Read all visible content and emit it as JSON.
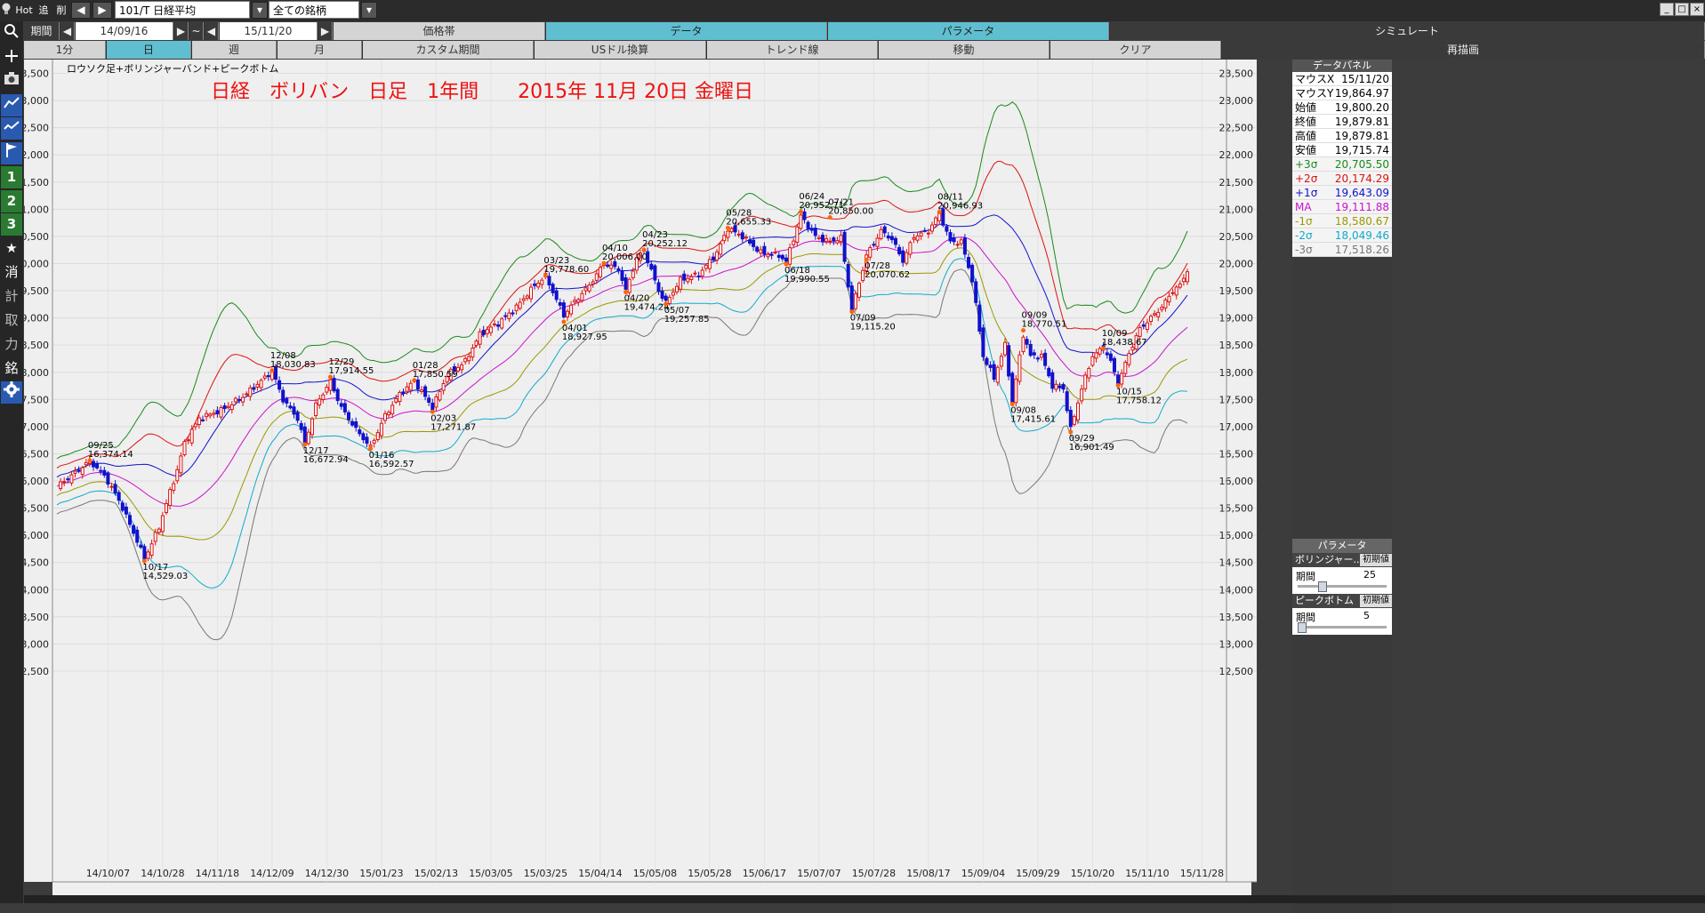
{
  "toolbar": {
    "hot": "Hot",
    "add": "追",
    "del": "削",
    "prev": "◀",
    "next": "▶",
    "symbol": "101/T 日経平均",
    "universe": "全ての銘柄",
    "period_label": "期間",
    "date_from": "14/09/16",
    "tilde": "~",
    "date_to": "15/11/20"
  },
  "menu_row": [
    "価格帯",
    "データ",
    "パラメータ",
    "シミュレート"
  ],
  "timeframe_row": [
    "1分",
    "日",
    "週",
    "月",
    "カスタム期間",
    "USドル換算",
    "トレンド線",
    "移動",
    "クリア",
    "再描画"
  ],
  "chart_subtitle": "ロウソク足+ボリンジャーバンド+ピークボトム",
  "chart_heading": "日経　ボリバン　日足　1年間　　2015年 11月 20日 金曜日",
  "data_panel": {
    "title": "データパネル",
    "rows": [
      {
        "k": "マウスX",
        "v": "15/11/20",
        "color": "#000000"
      },
      {
        "k": "マウスY",
        "v": "19,864.97",
        "color": "#000000"
      },
      {
        "k": "始値",
        "v": "19,800.20",
        "color": "#000000"
      },
      {
        "k": "終値",
        "v": "19,879.81",
        "color": "#000000"
      },
      {
        "k": "高値",
        "v": "19,879.81",
        "color": "#000000"
      },
      {
        "k": "安値",
        "v": "19,715.74",
        "color": "#000000"
      },
      {
        "k": "+3σ",
        "v": "20,705.50",
        "color": "#1a8a1a"
      },
      {
        "k": "+2σ",
        "v": "20,174.29",
        "color": "#dd1111"
      },
      {
        "k": "+1σ",
        "v": "19,643.09",
        "color": "#1111cc"
      },
      {
        "k": "MA",
        "v": "19,111.88",
        "color": "#cc11cc"
      },
      {
        "k": "-1σ",
        "v": "18,580.67",
        "color": "#999900"
      },
      {
        "k": "-2σ",
        "v": "18,049.46",
        "color": "#11aacc"
      },
      {
        "k": "-3σ",
        "v": "17,518.26",
        "color": "#777777"
      }
    ]
  },
  "params": {
    "title": "パラメータ",
    "groups": [
      {
        "name": "ボリンジャー...",
        "init": "初期値",
        "label": "期間",
        "value": "25",
        "level": 0.25
      },
      {
        "name": "ピークボトム",
        "init": "初期値",
        "label": "期間",
        "value": "5",
        "level": 0.0
      }
    ]
  },
  "colors": {
    "plus3": "#1a8a1a",
    "plus2": "#dd1111",
    "plus1": "#1111cc",
    "ma": "#cc11cc",
    "minus1": "#999900",
    "minus2": "#11aacc",
    "minus3": "#777777",
    "up": "#dd1111",
    "down": "#1111cc",
    "peak": "#ff6600"
  },
  "sidebar_icons": [
    "search-icon",
    "plus-icon",
    "camera-icon",
    "line-chart-icon",
    "line-chart-icon",
    "flag-icon",
    "1",
    "2",
    "3",
    "★",
    "消",
    "計",
    "取",
    "力",
    "銘",
    "gear-icon"
  ],
  "chart_data": {
    "type": "candlestick",
    "title": "日経　ボリバン　日足　1年間　　2015年 11月 20日 金曜日",
    "subtitle": "ロウソク足+ボリンジャーバンド+ピークボトム",
    "ylim": [
      12500,
      23700
    ],
    "yticks": [
      12500,
      13000,
      13500,
      14000,
      14500,
      15000,
      15500,
      16000,
      16500,
      17000,
      17500,
      18000,
      18500,
      19000,
      19500,
      20000,
      20500,
      21000,
      21500,
      22000,
      22500,
      23000,
      23500
    ],
    "x_labels": [
      {
        "i": 14,
        "label": "14/10/07"
      },
      {
        "i": 29,
        "label": "14/10/28"
      },
      {
        "i": 44,
        "label": "14/11/18"
      },
      {
        "i": 59,
        "label": "14/12/09"
      },
      {
        "i": 74,
        "label": "14/12/30"
      },
      {
        "i": 89,
        "label": "15/01/23"
      },
      {
        "i": 104,
        "label": "15/02/13"
      },
      {
        "i": 119,
        "label": "15/03/05"
      },
      {
        "i": 134,
        "label": "15/03/25"
      },
      {
        "i": 149,
        "label": "15/04/14"
      },
      {
        "i": 164,
        "label": "15/05/08"
      },
      {
        "i": 179,
        "label": "15/05/28"
      },
      {
        "i": 194,
        "label": "15/06/17"
      },
      {
        "i": 209,
        "label": "15/07/07"
      },
      {
        "i": 224,
        "label": "15/07/28"
      },
      {
        "i": 239,
        "label": "15/08/17"
      },
      {
        "i": 254,
        "label": "15/09/04"
      },
      {
        "i": 269,
        "label": "15/09/29"
      },
      {
        "i": 284,
        "label": "15/10/20"
      },
      {
        "i": 299,
        "label": "15/11/10"
      },
      {
        "i": 314,
        "label": "15/11/28"
      }
    ],
    "num_bars": 310,
    "keypoints": [
      [
        0,
        15900
      ],
      [
        5,
        16150
      ],
      [
        9,
        16370
      ],
      [
        13,
        16100
      ],
      [
        17,
        15650
      ],
      [
        22,
        14900
      ],
      [
        24,
        14560
      ],
      [
        28,
        15150
      ],
      [
        31,
        15800
      ],
      [
        33,
        16200
      ],
      [
        35,
        16700
      ],
      [
        39,
        17150
      ],
      [
        45,
        17300
      ],
      [
        51,
        17550
      ],
      [
        57,
        17900
      ],
      [
        59,
        18030
      ],
      [
        62,
        17500
      ],
      [
        66,
        17150
      ],
      [
        68,
        16680
      ],
      [
        71,
        17400
      ],
      [
        75,
        17830
      ],
      [
        78,
        17350
      ],
      [
        82,
        16950
      ],
      [
        86,
        16620
      ],
      [
        90,
        17200
      ],
      [
        94,
        17600
      ],
      [
        98,
        17840
      ],
      [
        103,
        17350
      ],
      [
        107,
        17950
      ],
      [
        112,
        18200
      ],
      [
        116,
        18700
      ],
      [
        121,
        18900
      ],
      [
        126,
        19200
      ],
      [
        131,
        19600
      ],
      [
        134,
        19770
      ],
      [
        139,
        19050
      ],
      [
        142,
        19300
      ],
      [
        146,
        19600
      ],
      [
        150,
        20000
      ],
      [
        154,
        19900
      ],
      [
        156,
        19500
      ],
      [
        159,
        20100
      ],
      [
        161,
        20240
      ],
      [
        165,
        19500
      ],
      [
        167,
        19280
      ],
      [
        171,
        19700
      ],
      [
        176,
        19800
      ],
      [
        181,
        20200
      ],
      [
        184,
        20650
      ],
      [
        188,
        20500
      ],
      [
        193,
        20200
      ],
      [
        198,
        20150
      ],
      [
        200,
        20040
      ],
      [
        204,
        20880
      ],
      [
        208,
        20500
      ],
      [
        212,
        20400
      ],
      [
        215,
        20480
      ],
      [
        218,
        19150
      ],
      [
        222,
        20150
      ],
      [
        226,
        20600
      ],
      [
        229,
        20450
      ],
      [
        232,
        20050
      ],
      [
        235,
        20500
      ],
      [
        239,
        20600
      ],
      [
        242,
        20930
      ],
      [
        245,
        20400
      ],
      [
        248,
        20400
      ],
      [
        251,
        19700
      ],
      [
        254,
        18300
      ],
      [
        257,
        17900
      ],
      [
        260,
        18500
      ],
      [
        262,
        17450
      ],
      [
        265,
        18700
      ],
      [
        267,
        18300
      ],
      [
        270,
        18300
      ],
      [
        273,
        17750
      ],
      [
        276,
        17700
      ],
      [
        278,
        16950
      ],
      [
        281,
        17700
      ],
      [
        284,
        18300
      ],
      [
        287,
        18450
      ],
      [
        289,
        18200
      ],
      [
        291,
        17780
      ],
      [
        294,
        18350
      ],
      [
        297,
        18800
      ],
      [
        300,
        19000
      ],
      [
        303,
        19200
      ],
      [
        306,
        19500
      ],
      [
        308,
        19600
      ],
      [
        310,
        19880
      ]
    ],
    "annotations": [
      {
        "date": "09/25",
        "value": "16,374.14",
        "kind": "peak"
      },
      {
        "date": "10/17",
        "value": "14,529.03",
        "kind": "bottom"
      },
      {
        "date": "12/08",
        "value": "18,030.83",
        "kind": "peak"
      },
      {
        "date": "12/17",
        "value": "16,672.94",
        "kind": "bottom"
      },
      {
        "date": "12/29",
        "value": "17,914.55",
        "kind": "peak"
      },
      {
        "date": "01/16",
        "value": "16,592.57",
        "kind": "bottom"
      },
      {
        "date": "01/28",
        "value": "17,850.59",
        "kind": "peak"
      },
      {
        "date": "02/03",
        "value": "17,271.87",
        "kind": "bottom"
      },
      {
        "date": "03/23",
        "value": "19,778.60",
        "kind": "peak"
      },
      {
        "date": "04/01",
        "value": "18,927.95",
        "kind": "bottom"
      },
      {
        "date": "04/10",
        "value": "20,006.00",
        "kind": "peak"
      },
      {
        "date": "04/20",
        "value": "19,474.24",
        "kind": "bottom"
      },
      {
        "date": "04/23",
        "value": "20,252.12",
        "kind": "peak"
      },
      {
        "date": "05/07",
        "value": "19,257.85",
        "kind": "bottom"
      },
      {
        "date": "05/28",
        "value": "20,655.33",
        "kind": "peak"
      },
      {
        "date": "06/18",
        "value": "19,990.55",
        "kind": "bottom"
      },
      {
        "date": "06/24",
        "value": "20,952.71",
        "kind": "peak"
      },
      {
        "date": "07/09",
        "value": "19,115.20",
        "kind": "bottom"
      },
      {
        "date": "07/21",
        "value": "20,850.00",
        "kind": "peak"
      },
      {
        "date": "07/28",
        "value": "20,070.62",
        "kind": "bottom"
      },
      {
        "date": "08/11",
        "value": "20,946.93",
        "kind": "peak"
      },
      {
        "date": "09/08",
        "value": "17,415.61",
        "kind": "bottom"
      },
      {
        "date": "09/09",
        "value": "18,770.51",
        "kind": "peak"
      },
      {
        "date": "09/29",
        "value": "16,901.49",
        "kind": "bottom"
      },
      {
        "date": "10/09",
        "value": "18,438.67",
        "kind": "peak"
      },
      {
        "date": "10/15",
        "value": "17,758.12",
        "kind": "bottom"
      }
    ],
    "band_period": 25,
    "band_sigmas": [
      3,
      2,
      1,
      0,
      -1,
      -2,
      -3
    ]
  }
}
